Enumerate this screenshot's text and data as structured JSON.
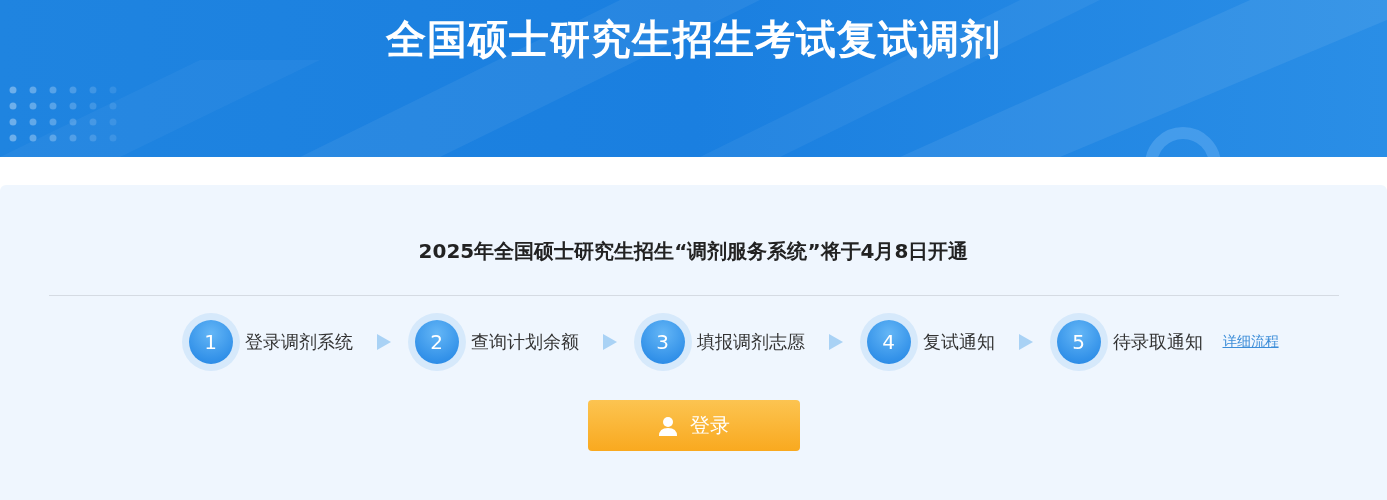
{
  "header": {
    "title": "全国硕士研究生招生考试复试调剂"
  },
  "notice": {
    "text": "2025年全国硕士研究生招生“调剂服务系统”将于4月8日开通"
  },
  "steps": [
    {
      "number": "1",
      "label": "登录调剂系统"
    },
    {
      "number": "2",
      "label": "查询计划余额"
    },
    {
      "number": "3",
      "label": "填报调剂志愿"
    },
    {
      "number": "4",
      "label": "复试通知"
    },
    {
      "number": "5",
      "label": "待录取通知"
    }
  ],
  "details_link": "详细流程",
  "login_button": "登录"
}
